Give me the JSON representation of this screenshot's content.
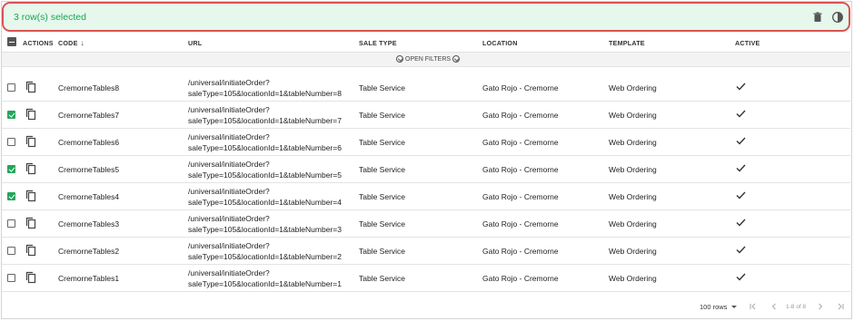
{
  "banner": {
    "text": "3 row(s) selected",
    "icons": [
      "trash-icon",
      "contrast-icon"
    ],
    "text_color": "#1aa655",
    "bg_color": "#e6f7ec",
    "highlight_border": "#d9534f"
  },
  "table": {
    "columns": {
      "actions": "ACTIONS",
      "code": "CODE",
      "url": "URL",
      "sale_type": "SALE TYPE",
      "location": "LOCATION",
      "template": "TEMPLATE",
      "active": "ACTIVE"
    },
    "sort": {
      "column": "code",
      "direction": "descending"
    },
    "filters_label": "OPEN FILTERS",
    "rows": [
      {
        "checked": false,
        "code": "CremorneTables8",
        "url_line1": "/universal/initiateOrder?",
        "url_line2": "saleType=105&locationId=1&tableNumber=8",
        "sale_type": "Table Service",
        "location": "Gato Rojo - Cremorne",
        "template": "Web Ordering",
        "active": true
      },
      {
        "checked": true,
        "code": "CremorneTables7",
        "url_line1": "/universal/initiateOrder?",
        "url_line2": "saleType=105&locationId=1&tableNumber=7",
        "sale_type": "Table Service",
        "location": "Gato Rojo - Cremorne",
        "template": "Web Ordering",
        "active": true
      },
      {
        "checked": false,
        "code": "CremorneTables6",
        "url_line1": "/universal/initiateOrder?",
        "url_line2": "saleType=105&locationId=1&tableNumber=6",
        "sale_type": "Table Service",
        "location": "Gato Rojo - Cremorne",
        "template": "Web Ordering",
        "active": true
      },
      {
        "checked": true,
        "code": "CremorneTables5",
        "url_line1": "/universal/initiateOrder?",
        "url_line2": "saleType=105&locationId=1&tableNumber=5",
        "sale_type": "Table Service",
        "location": "Gato Rojo - Cremorne",
        "template": "Web Ordering",
        "active": true
      },
      {
        "checked": true,
        "code": "CremorneTables4",
        "url_line1": "/universal/initiateOrder?",
        "url_line2": "saleType=105&locationId=1&tableNumber=4",
        "sale_type": "Table Service",
        "location": "Gato Rojo - Cremorne",
        "template": "Web Ordering",
        "active": true
      },
      {
        "checked": false,
        "code": "CremorneTables3",
        "url_line1": "/universal/initiateOrder?",
        "url_line2": "saleType=105&locationId=1&tableNumber=3",
        "sale_type": "Table Service",
        "location": "Gato Rojo - Cremorne",
        "template": "Web Ordering",
        "active": true
      },
      {
        "checked": false,
        "code": "CremorneTables2",
        "url_line1": "/universal/initiateOrder?",
        "url_line2": "saleType=105&locationId=1&tableNumber=2",
        "sale_type": "Table Service",
        "location": "Gato Rojo - Cremorne",
        "template": "Web Ordering",
        "active": true
      },
      {
        "checked": false,
        "code": "CremorneTables1",
        "url_line1": "/universal/initiateOrder?",
        "url_line2": "saleType=105&locationId=1&tableNumber=1",
        "sale_type": "Table Service",
        "location": "Gato Rojo - Cremorne",
        "template": "Web Ordering",
        "active": true
      }
    ],
    "row_icons": {
      "action": "copy-icon",
      "active": "checkmark-icon"
    },
    "checkbox_checked_color": "#24a55a"
  },
  "footer": {
    "rows_per_page": "100 rows",
    "page_info": "1-8 of 8",
    "icons": [
      "first-page-icon",
      "prev-page-icon",
      "next-page-icon",
      "last-page-icon"
    ]
  }
}
